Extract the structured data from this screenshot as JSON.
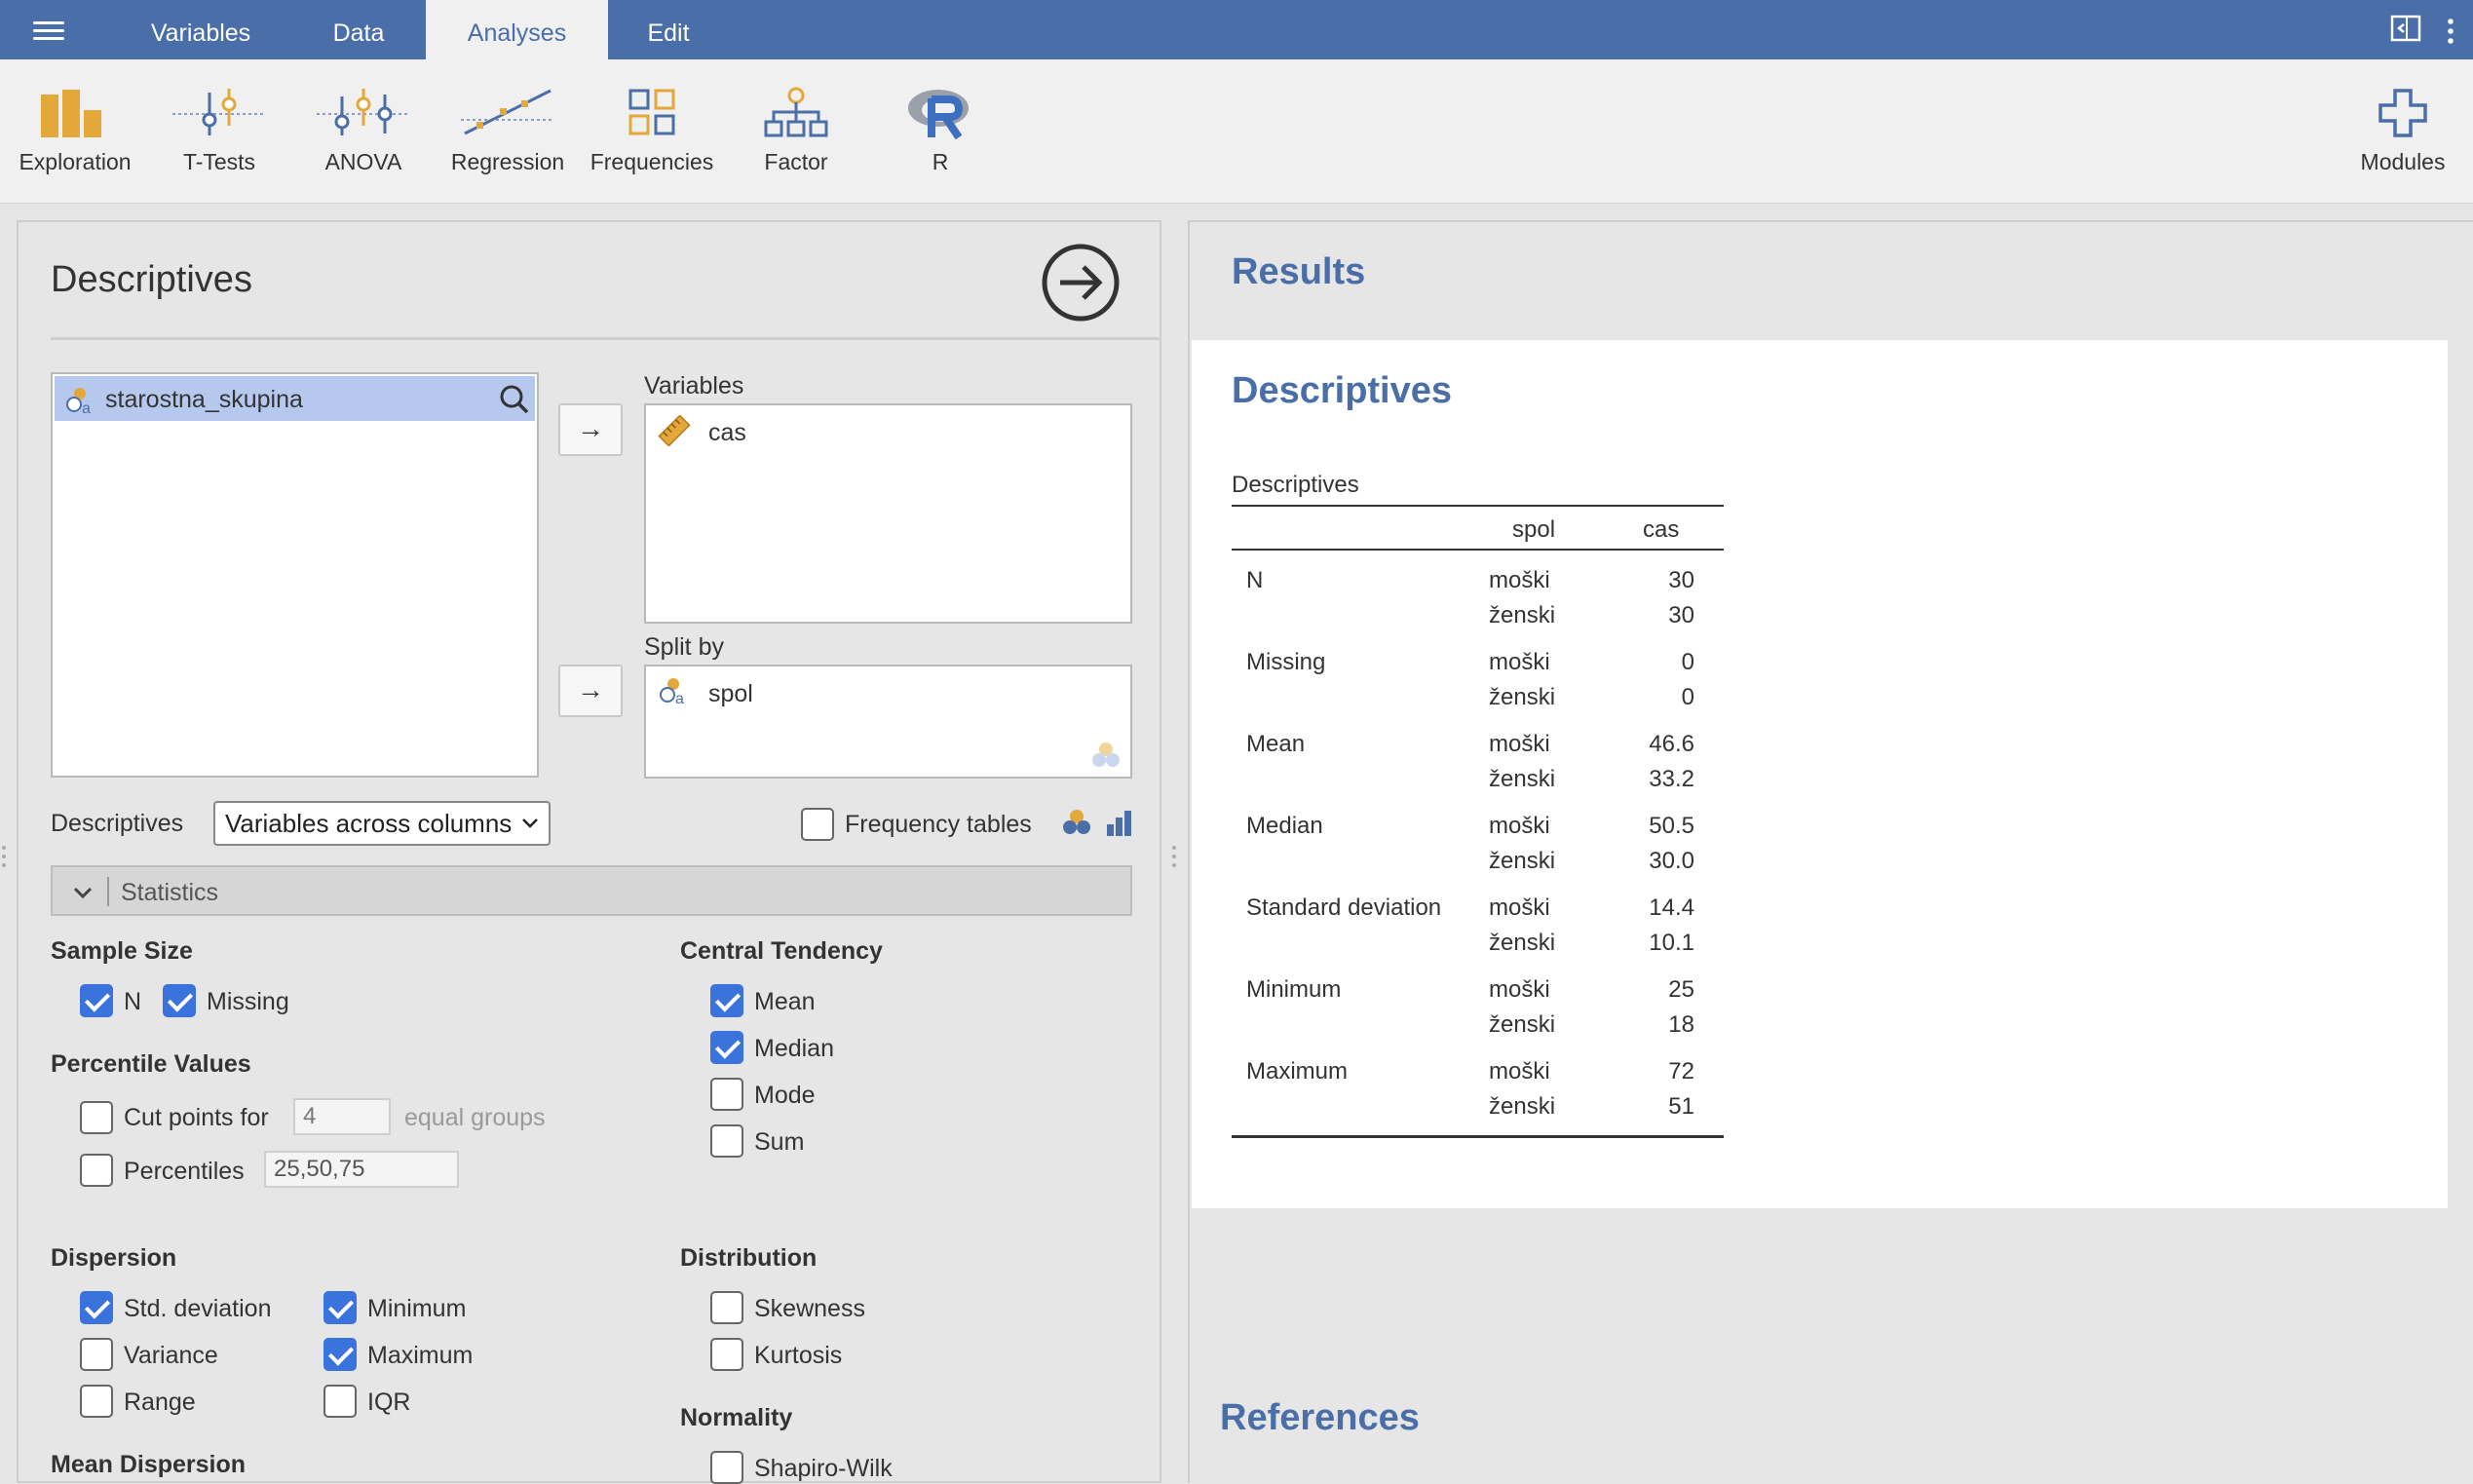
{
  "nav": {
    "tabs": [
      {
        "label": "Variables",
        "active": false
      },
      {
        "label": "Data",
        "active": false
      },
      {
        "label": "Analyses",
        "active": true
      },
      {
        "label": "Edit",
        "active": false
      }
    ]
  },
  "ribbon": {
    "items": [
      {
        "label": "Exploration",
        "icon": "exploration-icon"
      },
      {
        "label": "T-Tests",
        "icon": "t-tests-icon"
      },
      {
        "label": "ANOVA",
        "icon": "anova-icon"
      },
      {
        "label": "Regression",
        "icon": "regression-icon"
      },
      {
        "label": "Frequencies",
        "icon": "frequencies-icon"
      },
      {
        "label": "Factor",
        "icon": "factor-icon"
      },
      {
        "label": "R",
        "icon": "r-icon"
      }
    ],
    "modules_label": "Modules"
  },
  "analysis": {
    "title": "Descriptives",
    "source_variables": [
      "starostna_skupina"
    ],
    "variables_label": "Variables",
    "variables": [
      "cas"
    ],
    "split_by_label": "Split by",
    "split_by": [
      "spol"
    ],
    "descriptives_label": "Descriptives",
    "descriptives_mode": "Variables across columns",
    "frequency_tables_label": "Frequency tables",
    "frequency_tables": false
  },
  "statistics": {
    "header": "Statistics",
    "sample_size": {
      "title": "Sample Size",
      "n": {
        "label": "N",
        "checked": true
      },
      "missing": {
        "label": "Missing",
        "checked": true
      }
    },
    "percentile_values": {
      "title": "Percentile Values",
      "cut_points": {
        "label": "Cut points for",
        "value": "4",
        "suffix": "equal groups",
        "checked": false
      },
      "percentiles": {
        "label": "Percentiles",
        "value": "25,50,75",
        "checked": false
      }
    },
    "central_tendency": {
      "title": "Central Tendency",
      "mean": {
        "label": "Mean",
        "checked": true
      },
      "median": {
        "label": "Median",
        "checked": true
      },
      "mode": {
        "label": "Mode",
        "checked": false
      },
      "sum": {
        "label": "Sum",
        "checked": false
      }
    },
    "dispersion": {
      "title": "Dispersion",
      "std": {
        "label": "Std. deviation",
        "checked": true
      },
      "variance": {
        "label": "Variance",
        "checked": false
      },
      "range": {
        "label": "Range",
        "checked": false
      },
      "minimum": {
        "label": "Minimum",
        "checked": true
      },
      "maximum": {
        "label": "Maximum",
        "checked": true
      },
      "iqr": {
        "label": "IQR",
        "checked": false
      }
    },
    "distribution": {
      "title": "Distribution",
      "skewness": {
        "label": "Skewness",
        "checked": false
      },
      "kurtosis": {
        "label": "Kurtosis",
        "checked": false
      }
    },
    "normality": {
      "title": "Normality",
      "shapiro": {
        "label": "Shapiro-Wilk",
        "checked": false
      }
    },
    "mean_dispersion": {
      "title": "Mean Dispersion"
    }
  },
  "results": {
    "heading": "Results",
    "section_title": "Descriptives",
    "table": {
      "caption": "Descriptives",
      "headers": {
        "group": "spol",
        "value": "cas"
      },
      "rows": [
        {
          "stat": "N",
          "values": [
            {
              "group": "moški",
              "value": "30"
            },
            {
              "group": "ženski",
              "value": "30"
            }
          ]
        },
        {
          "stat": "Missing",
          "values": [
            {
              "group": "moški",
              "value": "0"
            },
            {
              "group": "ženski",
              "value": "0"
            }
          ]
        },
        {
          "stat": "Mean",
          "values": [
            {
              "group": "moški",
              "value": "46.6"
            },
            {
              "group": "ženski",
              "value": "33.2"
            }
          ]
        },
        {
          "stat": "Median",
          "values": [
            {
              "group": "moški",
              "value": "50.5"
            },
            {
              "group": "ženski",
              "value": "30.0"
            }
          ]
        },
        {
          "stat": "Standard deviation",
          "values": [
            {
              "group": "moški",
              "value": "14.4"
            },
            {
              "group": "ženski",
              "value": "10.1"
            }
          ]
        },
        {
          "stat": "Minimum",
          "values": [
            {
              "group": "moški",
              "value": "25"
            },
            {
              "group": "ženski",
              "value": "18"
            }
          ]
        },
        {
          "stat": "Maximum",
          "values": [
            {
              "group": "moški",
              "value": "72"
            },
            {
              "group": "ženski",
              "value": "51"
            }
          ]
        }
      ]
    },
    "references_heading": "References"
  },
  "colors": {
    "brand": "#4a6ea8",
    "checkbox_on": "#3b73dc",
    "selected_row": "#b7c8ee"
  }
}
